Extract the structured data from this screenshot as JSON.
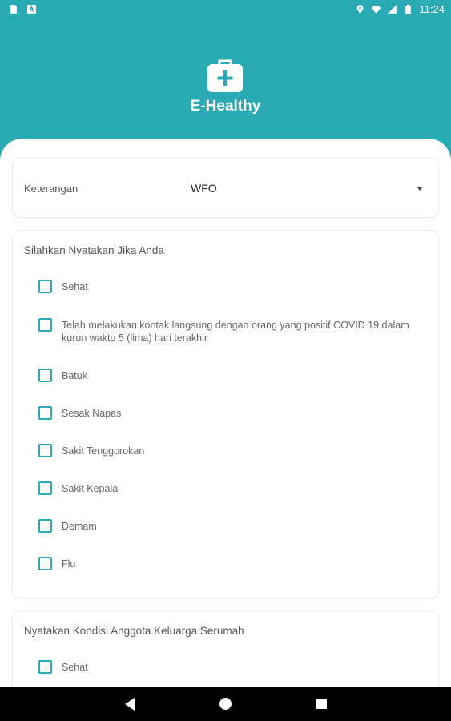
{
  "status_bar": {
    "time": "11:24",
    "left_icons": [
      "sim-card-icon",
      "app-a-icon"
    ],
    "right_icons": [
      "location-icon",
      "wifi-icon",
      "signal-icon",
      "battery-icon"
    ]
  },
  "header": {
    "logo_icon": "medical-kit-icon",
    "title": "E-Healthy"
  },
  "keterangan": {
    "label": "Keterangan",
    "value": "WFO"
  },
  "section_symptoms": {
    "title": "Silahkan Nyatakan Jika Anda",
    "items": [
      {
        "label": "Sehat",
        "checked": false
      },
      {
        "label": "Telah melakukan kontak langsung dengan orang yang positif COVID 19 dalam kurun waktu 5 (lima) hari terakhir",
        "checked": false
      },
      {
        "label": "Batuk",
        "checked": false
      },
      {
        "label": "Sesak Napas",
        "checked": false
      },
      {
        "label": "Sakit Tenggorokan",
        "checked": false
      },
      {
        "label": "Sakit Kepala",
        "checked": false
      },
      {
        "label": "Demam",
        "checked": false
      },
      {
        "label": "Flu",
        "checked": false
      }
    ]
  },
  "section_family": {
    "title": "Nyatakan Kondisi Anggota Keluarga Serumah",
    "items": [
      {
        "label": "Sehat",
        "checked": false
      }
    ]
  },
  "nav": {
    "icons": [
      "back-icon",
      "home-icon",
      "recents-icon"
    ]
  },
  "colors": {
    "primary": "#29aab5",
    "checkbox_border": "#29aab5",
    "navbar": "#000000"
  }
}
